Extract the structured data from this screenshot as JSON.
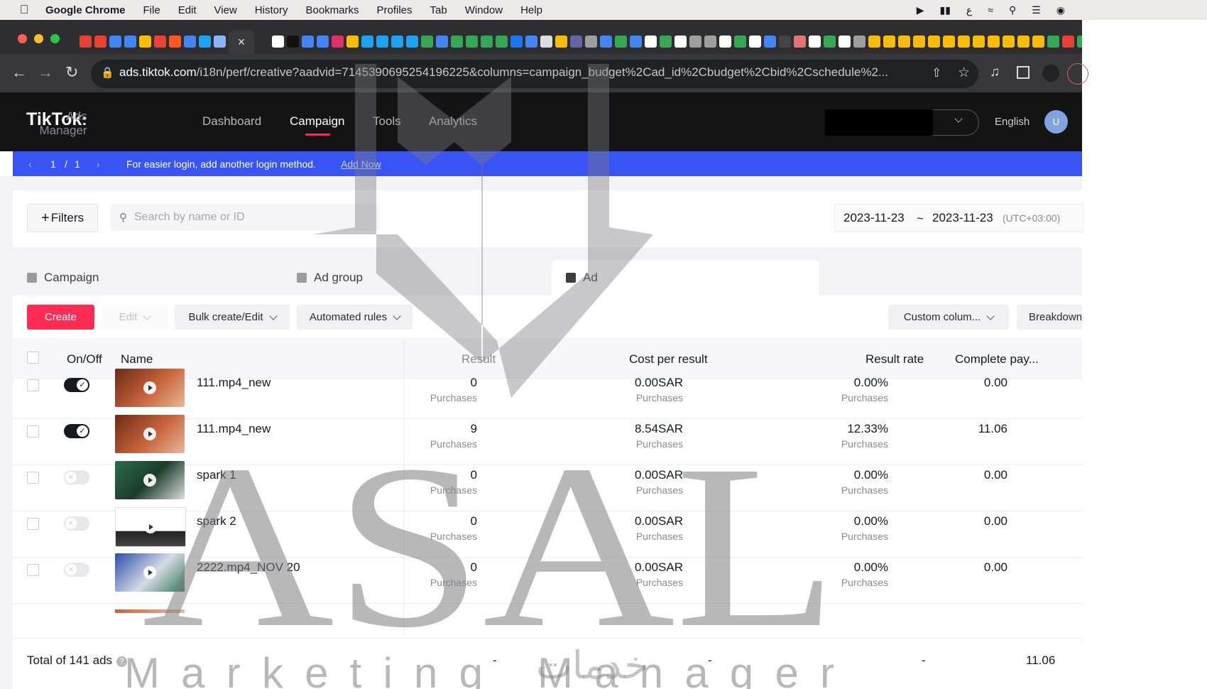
{
  "menubar": {
    "items": [
      "Google Chrome",
      "File",
      "Edit",
      "View",
      "History",
      "Bookmarks",
      "Profiles",
      "Tab",
      "Window",
      "Help"
    ]
  },
  "browser": {
    "url_domain": "ads.tiktok.com",
    "url_path": "/i18n/perf/creative?aadvid=7145390695254196225&columns=campaign_budget%2Cad_id%2Cbudget%2Cbid%2Cschedule%2..."
  },
  "header": {
    "logo": "TikTok",
    "logo_sub": "Ads Manager",
    "nav": [
      "Dashboard",
      "Campaign",
      "Tools",
      "Analytics"
    ],
    "active_nav": "Campaign",
    "language": "English",
    "avatar_letter": "U"
  },
  "banner": {
    "page_current": "1",
    "page_sep": "/",
    "page_total": "1",
    "message": "For easier login, add another login method.",
    "link": "Add Now"
  },
  "toolbar": {
    "filters_label": "Filters",
    "search_placeholder": "Search by name or ID",
    "date_start": "2023-11-23",
    "date_sep": "~",
    "date_end": "2023-11-23",
    "timezone": "(UTC+03:00)"
  },
  "level_tabs": [
    "Campaign",
    "Ad group",
    "Ad"
  ],
  "actions": {
    "create": "Create",
    "edit": "Edit",
    "bulk": "Bulk create/Edit",
    "automated": "Automated rules",
    "custom_columns": "Custom colum...",
    "breakdown": "Breakdown"
  },
  "table": {
    "headers": [
      "On/Off",
      "Name",
      "Result",
      "Cost per result",
      "Result rate",
      "Complete pay..."
    ],
    "rows": [
      {
        "on": true,
        "name": "111.mp4_new",
        "result": "0",
        "result_sub": "Purchases",
        "cpr": "0.00SAR",
        "cpr_sub": "Purchases",
        "rate": "0.00%",
        "rate_sub": "Purchases",
        "complete": "0.00"
      },
      {
        "on": true,
        "name": "111.mp4_new",
        "result": "9",
        "result_sub": "Purchases",
        "cpr": "8.54SAR",
        "cpr_sub": "Purchases",
        "rate": "12.33%",
        "rate_sub": "Purchases",
        "complete": "11.06"
      },
      {
        "on": false,
        "name": "spark 1",
        "result": "0",
        "result_sub": "Purchases",
        "cpr": "0.00SAR",
        "cpr_sub": "Purchases",
        "rate": "0.00%",
        "rate_sub": "Purchases",
        "complete": "0.00"
      },
      {
        "on": false,
        "name": "spark 2",
        "result": "0",
        "result_sub": "Purchases",
        "cpr": "0.00SAR",
        "cpr_sub": "Purchases",
        "rate": "0.00%",
        "rate_sub": "Purchases",
        "complete": "0.00"
      },
      {
        "on": false,
        "name": "2222.mp4_NOV 20",
        "result": "0",
        "result_sub": "Purchases",
        "cpr": "0.00SAR",
        "cpr_sub": "Purchases",
        "rate": "0.00%",
        "rate_sub": "Purchases",
        "complete": "0.00"
      }
    ],
    "total_label": "Total of 141 ads",
    "total_result": "-",
    "total_cpr": "-",
    "total_rate": "-",
    "total_complete": "11.06"
  },
  "watermark": {
    "big": "ASAL",
    "small": "Marketing Manager",
    "arabic": "خدمات"
  }
}
